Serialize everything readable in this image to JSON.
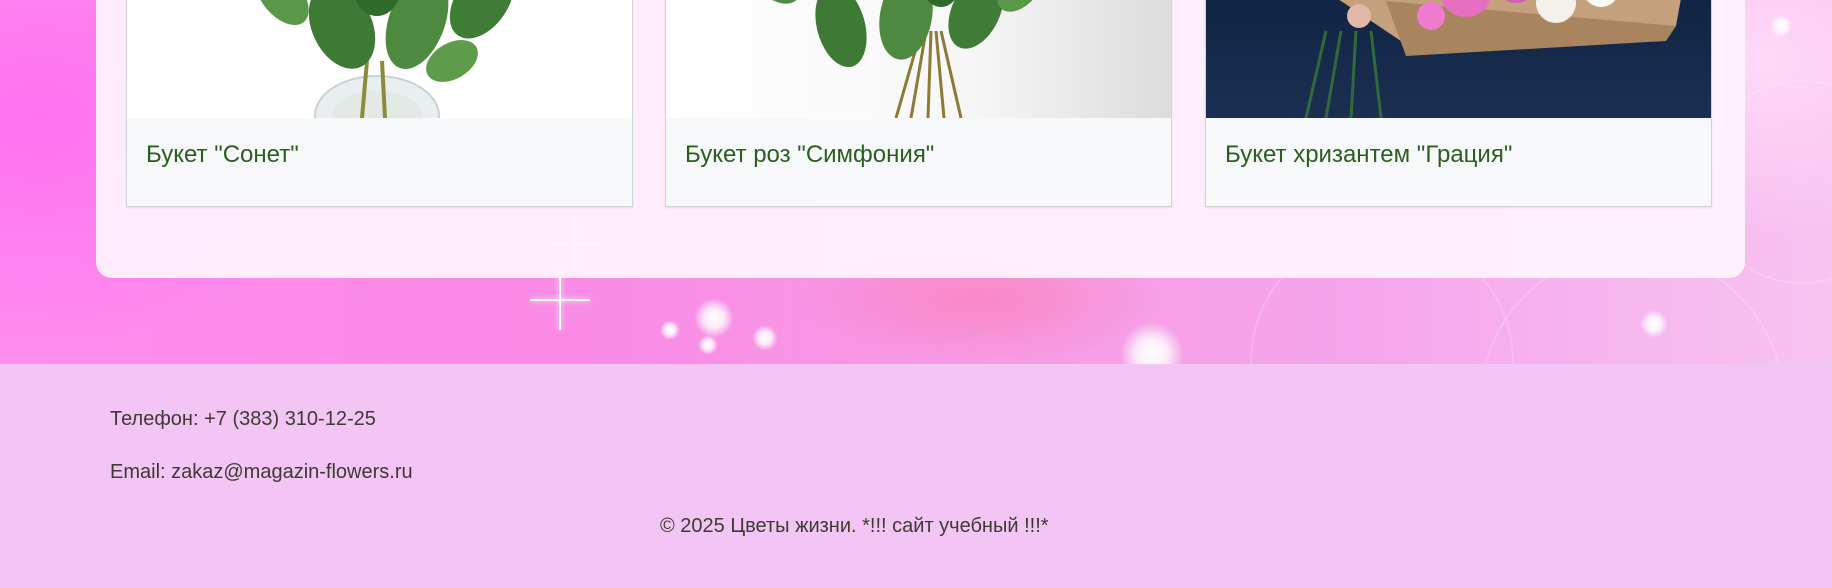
{
  "products": [
    {
      "title": "Букет \"Сонет\"",
      "image_desc": "rose-bouquet-vase-image"
    },
    {
      "title": "Букет роз \"Симфония\"",
      "image_desc": "rose-symphony-image"
    },
    {
      "title": "Букет хризантем \"Грация\"",
      "image_desc": "chrysanthemum-bouquet-image"
    }
  ],
  "footer": {
    "phone": "Телефон: +7 (383) 310-12-25",
    "email": "Email: zakaz@magazin-flowers.ru",
    "copyright": "© 2025 Цветы жизни. *!!! сайт учебный !!!*"
  },
  "colors": {
    "title_green": "#2c5e1e",
    "footer_bg": "#f3c5f4",
    "page_pink": "#f98ae6"
  }
}
